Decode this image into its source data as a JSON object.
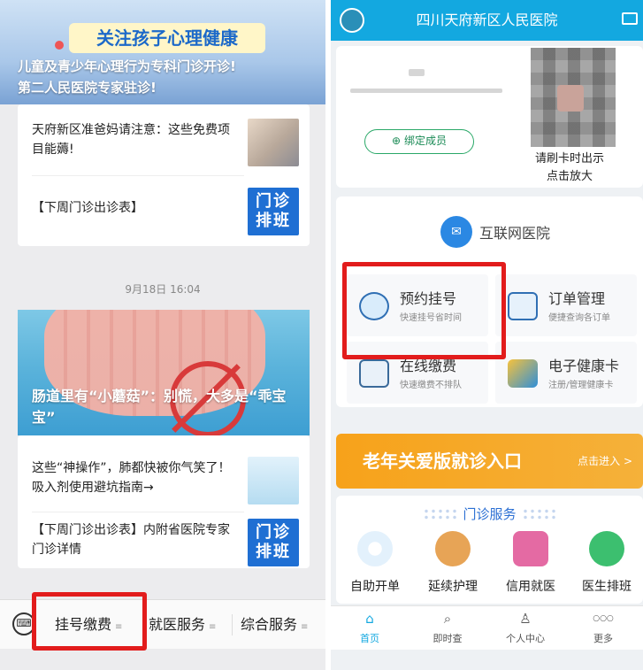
{
  "left": {
    "article1": {
      "banner": "关注孩子心理健康",
      "line1": "儿童及青少年心理行为专科门诊开诊!",
      "line2": "第二人民医院专家驻诊!"
    },
    "items1": [
      {
        "title": "天府新区准爸妈请注意：这些免费项目能薅!",
        "thumb": "baby-photo"
      },
      {
        "title": "【下周门诊出诊表】",
        "thumb_text": "门诊排班"
      }
    ],
    "timestamp": "9月18日 16:04",
    "article2": {
      "overlay": "肠道里有“小蘑菇”：别慌，大多是“乖宝宝”"
    },
    "items2": [
      {
        "title": "这些“神操作”，肺都快被你气笑了！吸入剂使用避坑指南→",
        "thumb": "inhaler-photo"
      },
      {
        "title": "【下周门诊出诊表】内附省医院专家门诊详情",
        "thumb_text": "门诊排班"
      }
    ],
    "menu": {
      "items": [
        {
          "label": "挂号缴费"
        },
        {
          "label": "就医服务"
        },
        {
          "label": "综合服务"
        }
      ],
      "sub_icon": "≡"
    }
  },
  "right": {
    "header": {
      "title": "四川天府新区人民医院"
    },
    "member": {
      "bind_label": "绑定成员",
      "qr_tip_1": "请刷卡时出示",
      "qr_tip_2": "点击放大"
    },
    "internet_hospital": "互联网医院",
    "tiles": [
      {
        "title": "预约挂号",
        "sub": "快速挂号省时间"
      },
      {
        "title": "订单管理",
        "sub": "便捷查询各订单"
      },
      {
        "title": "在线缴费",
        "sub": "快速缴费不排队"
      },
      {
        "title": "电子健康卡",
        "sub": "注册/管理健康卡"
      }
    ],
    "elder": {
      "label": "老年关爱版就诊入口",
      "go": "点击进入 >"
    },
    "outpatient": {
      "title": "门诊服务",
      "items": [
        {
          "label": "自助开单"
        },
        {
          "label": "延续护理"
        },
        {
          "label": "信用就医"
        },
        {
          "label": "医生排班"
        }
      ]
    },
    "tabs": [
      {
        "label": "首页",
        "icon": "⌂"
      },
      {
        "label": "即时查",
        "icon": "⌕"
      },
      {
        "label": "个人中心",
        "icon": "♙"
      },
      {
        "label": "更多",
        "icon": "○○○"
      }
    ]
  }
}
